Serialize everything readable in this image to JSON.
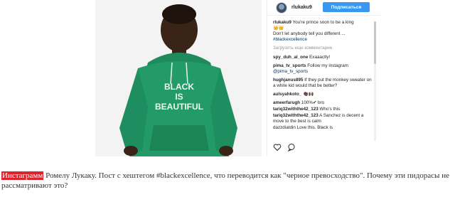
{
  "post": {
    "hoodie_text": [
      "BLACK",
      "IS",
      "BEAUTIFUL"
    ]
  },
  "instagram": {
    "username": "rlukaku9",
    "follow_label": "Подписаться",
    "caption": {
      "user": "rlukaku9",
      "text": "You're prince soon to be a king",
      "emoji": "👑👑",
      "line2": "Don't let anybody tell you different ...",
      "hashtag": "#blackexcellence"
    },
    "load_more": "Загрузить еще комментарии",
    "comments": [
      {
        "user": "spy_duh_al_one",
        "text": "Exaaactly!"
      },
      {
        "user": "pima_tv_sports",
        "text": "Follow my instagram",
        "mention": "@pima_tv_sports"
      },
      {
        "user": "hughjanus895",
        "text": "If they put the monkey sweater on a white kid would that be better?"
      },
      {
        "user": "aulsyahkoto_",
        "text": "👏🏿🙌🏿"
      },
      {
        "user": "ameerfarugh",
        "text": "100%✔ bro"
      },
      {
        "user": "tariq32withthe42_123",
        "text": "Who's this"
      },
      {
        "user": "tariq32withthe42_123",
        "text": "A Sanchez is decent a move to the best is calm"
      },
      {
        "user": "",
        "text": "dazzdiatdin Love this. Black is"
      }
    ],
    "icons": [
      "heart-icon",
      "comment-icon"
    ]
  },
  "caption": {
    "highlight": "Инстаграмм",
    "text": " Ромелу Лукаку. Пост с хештегом #blackexcellence, что переводится как \"черное превосходство\". Почему эти пидорасы не рассматривают это?"
  }
}
